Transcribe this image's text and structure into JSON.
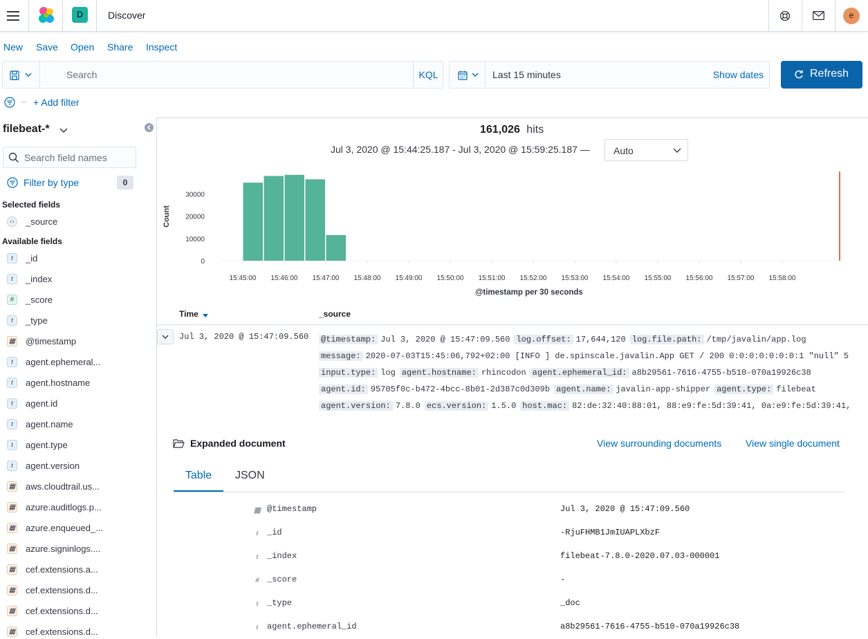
{
  "app": {
    "title": "Discover",
    "space_badge": "D",
    "user_initial": "e"
  },
  "menu": {
    "new": "New",
    "save": "Save",
    "open": "Open",
    "share": "Share",
    "inspect": "Inspect"
  },
  "query": {
    "placeholder": "Search",
    "language": "KQL"
  },
  "time": {
    "range_label": "Last 15 minutes",
    "show_dates": "Show dates",
    "refresh": "Refresh"
  },
  "filters": {
    "add_filter": "+ Add filter"
  },
  "sidebar": {
    "index_pattern": "filebeat-*",
    "search_placeholder": "Search field names",
    "filter_by_type": "Filter by type",
    "filter_count": "0",
    "selected_heading": "Selected fields",
    "available_heading": "Available fields",
    "selected_fields": [
      {
        "name": "_source",
        "type": "source"
      }
    ],
    "available_fields": [
      {
        "name": "_id",
        "type": "string"
      },
      {
        "name": "_index",
        "type": "string"
      },
      {
        "name": "_score",
        "type": "number"
      },
      {
        "name": "_type",
        "type": "string"
      },
      {
        "name": "@timestamp",
        "type": "date"
      },
      {
        "name": "agent.ephemeral...",
        "type": "string"
      },
      {
        "name": "agent.hostname",
        "type": "string"
      },
      {
        "name": "agent.id",
        "type": "string"
      },
      {
        "name": "agent.name",
        "type": "string"
      },
      {
        "name": "agent.type",
        "type": "string"
      },
      {
        "name": "agent.version",
        "type": "string"
      },
      {
        "name": "aws.cloudtrail.us...",
        "type": "date"
      },
      {
        "name": "azure.auditlogs.p...",
        "type": "date"
      },
      {
        "name": "azure.enqueued_...",
        "type": "date"
      },
      {
        "name": "azure.signinlogs....",
        "type": "date"
      },
      {
        "name": "cef.extensions.a...",
        "type": "date"
      },
      {
        "name": "cef.extensions.d...",
        "type": "date"
      },
      {
        "name": "cef.extensions.d...",
        "type": "date"
      },
      {
        "name": "cef.extensions.d...",
        "type": "date"
      }
    ]
  },
  "results": {
    "hits_count": "161,026",
    "hits_label": "hits",
    "range_text": "Jul 3, 2020 @ 15:44:25.187 - Jul 3, 2020 @ 15:59:25.187 —",
    "interval": "Auto"
  },
  "chart_data": {
    "type": "bar",
    "xlabel": "@timestamp per 30 seconds",
    "ylabel": "Count",
    "ylim": [
      0,
      40000
    ],
    "yticks": [
      0,
      10000,
      20000,
      30000
    ],
    "xticks": [
      "15:45:00",
      "15:46:00",
      "15:47:00",
      "15:48:00",
      "15:49:00",
      "15:50:00",
      "15:51:00",
      "15:52:00",
      "15:53:00",
      "15:54:00",
      "15:55:00",
      "15:56:00",
      "15:57:00",
      "15:58:00"
    ],
    "bar_color": "#54b399",
    "bars": [
      {
        "x": "15:45:00",
        "value": 35000
      },
      {
        "x": "15:45:30",
        "value": 38000
      },
      {
        "x": "15:46:00",
        "value": 38500
      },
      {
        "x": "15:46:30",
        "value": 36500
      },
      {
        "x": "15:47:00",
        "value": 11500
      }
    ],
    "marker_color": "#e7664c"
  },
  "table": {
    "time_header": "Time",
    "source_header": "_source",
    "row": {
      "time": "Jul 3, 2020 @ 15:47:09.560",
      "source_lines": [
        [
          [
            "@timestamp:",
            "Jul 3, 2020 @ 15:47:09.560"
          ],
          [
            "log.offset:",
            "17,644,120"
          ],
          [
            "log.file.path:",
            "/tmp/javalin/app.log"
          ]
        ],
        [
          [
            "message:",
            "2020-07-03T15:45:06,792+02:00 [INFO ] de.spinscale.javalin.App GET / 200 0:0:0:0:0:0:0:1 \"null\" 5"
          ]
        ],
        [
          [
            "input.type:",
            "log"
          ],
          [
            "agent.hostname:",
            "rhincodon"
          ],
          [
            "agent.ephemeral_id:",
            "a8b29561-7616-4755-b510-070a19926c38"
          ]
        ],
        [
          [
            "agent.id:",
            "95705f0c-b472-4bcc-8b01-2d387c0d309b"
          ],
          [
            "agent.name:",
            "javalin-app-shipper"
          ],
          [
            "agent.type:",
            "filebeat"
          ]
        ],
        [
          [
            "agent.version:",
            "7.8.0"
          ],
          [
            "ecs.version:",
            "1.5.0"
          ],
          [
            "host.mac:",
            "82:de:32:40:88:01, 88:e9:fe:5d:39:41, 0a:e9:fe:5d:39:41,"
          ]
        ]
      ]
    }
  },
  "expanded": {
    "title": "Expanded document",
    "view_surrounding": "View surrounding documents",
    "view_single": "View single document",
    "tab_table": "Table",
    "tab_json": "JSON",
    "rows": [
      {
        "icon": "date",
        "field": "@timestamp",
        "value": "Jul 3, 2020 @ 15:47:09.560"
      },
      {
        "icon": "t",
        "field": "_id",
        "value": "-RjuFHMB1JmIUAPLXbzF"
      },
      {
        "icon": "t",
        "field": "_index",
        "value": "filebeat-7.8.0-2020.07.03-000001"
      },
      {
        "icon": "#",
        "field": "_score",
        "value": " -"
      },
      {
        "icon": "t",
        "field": "_type",
        "value": "_doc"
      },
      {
        "icon": "t",
        "field": "agent.ephemeral_id",
        "value": "a8b29561-7616-4755-b510-070a19926c38"
      }
    ]
  }
}
